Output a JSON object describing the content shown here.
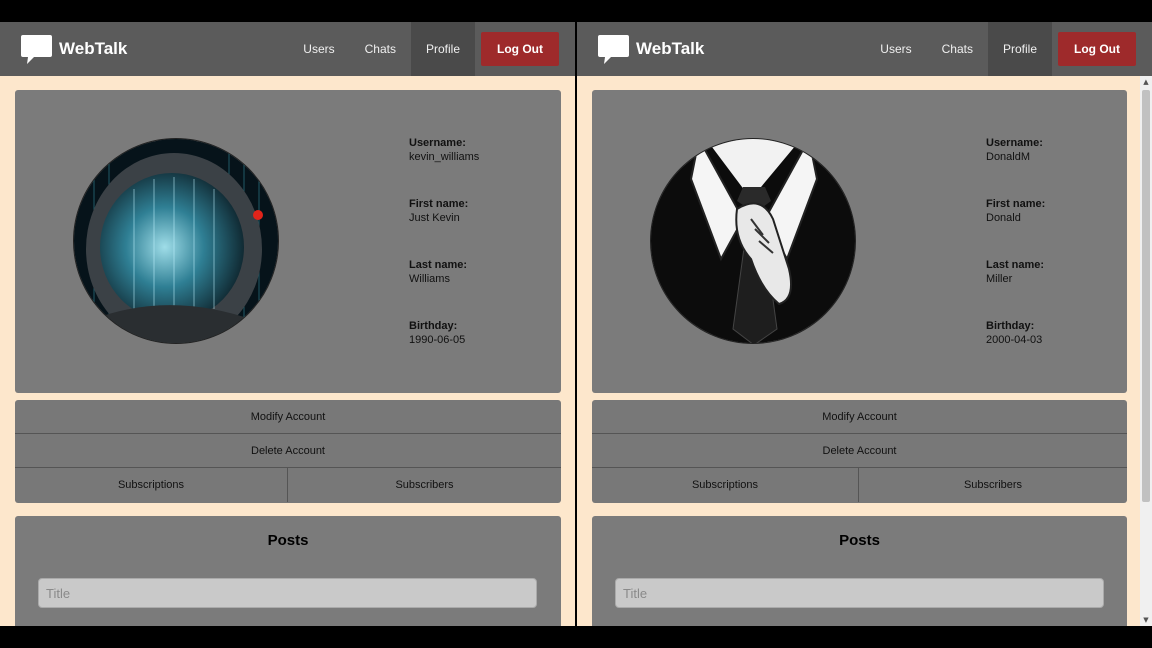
{
  "brand": {
    "name": "WebTalk",
    "logo_icon": "speech-bubble-icon"
  },
  "nav": {
    "users": "Users",
    "chats": "Chats",
    "profile": "Profile",
    "logout": "Log Out"
  },
  "colors": {
    "navbar": "#5b5b5b",
    "page_bg": "#fde7cc",
    "card": "#7b7b7b",
    "logout": "#9e2a2b"
  },
  "left": {
    "profile": {
      "username_label": "Username:",
      "username": "kevin_williams",
      "first_label": "First name:",
      "first": "Just Kevin",
      "last_label": "Last name:",
      "last": "Williams",
      "birthday_label": "Birthday:",
      "birthday": "1990-06-05",
      "avatar": "astronaut-helmet-avatar"
    },
    "actions": {
      "modify": "Modify Account",
      "delete": "Delete Account",
      "subscriptions": "Subscriptions",
      "subscribers": "Subscribers"
    },
    "posts": {
      "title": "Posts",
      "title_placeholder": "Title"
    }
  },
  "right": {
    "profile": {
      "username_label": "Username:",
      "username": "DonaldM",
      "first_label": "First name:",
      "first": "Donald",
      "last_label": "Last name:",
      "last": "Miller",
      "birthday_label": "Birthday:",
      "birthday": "2000-04-03",
      "avatar": "suit-and-tie-avatar"
    },
    "actions": {
      "modify": "Modify Account",
      "delete": "Delete Account",
      "subscriptions": "Subscriptions",
      "subscribers": "Subscribers"
    },
    "posts": {
      "title": "Posts",
      "title_placeholder": "Title"
    }
  }
}
